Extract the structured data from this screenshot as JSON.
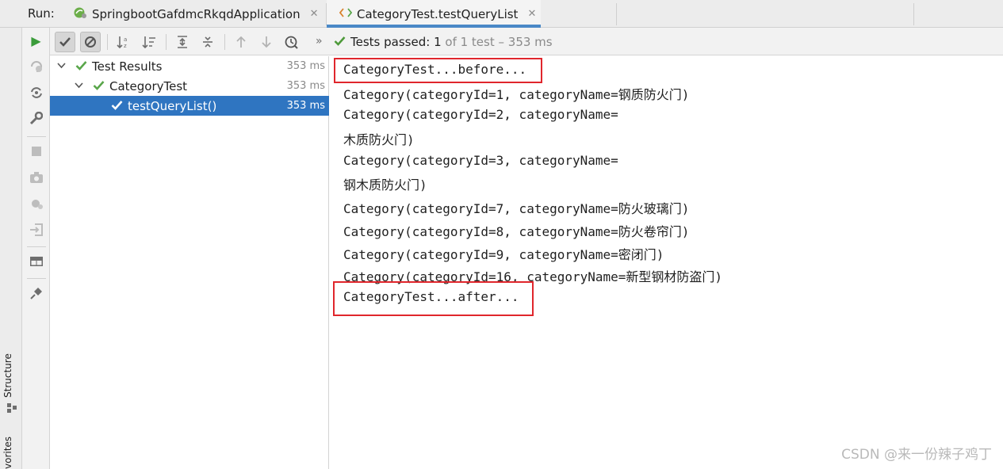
{
  "run_label": "Run:",
  "tabs": [
    {
      "label": "SpringbootGafdmcRkqdApplication",
      "close": "✕",
      "active": false
    },
    {
      "label": "CategoryTest.testQueryList",
      "close": "✕",
      "active": true
    }
  ],
  "side_labels": {
    "structure": "Structure",
    "favorites": "vorites"
  },
  "toolbar": {
    "more": "»",
    "status_prefix": "Tests passed:",
    "status_count": "1",
    "status_rest": "of 1 test – 353 ms"
  },
  "tree": [
    {
      "label": "Test Results",
      "duration": "353 ms",
      "level": 0,
      "selected": false
    },
    {
      "label": "CategoryTest",
      "duration": "353 ms",
      "level": 1,
      "selected": false
    },
    {
      "label": "testQueryList()",
      "duration": "353 ms",
      "level": 2,
      "selected": true
    }
  ],
  "console_lines": [
    "CategoryTest...before...",
    "Category(categoryId=1, categoryName=钢质防火门)",
    "Category(categoryId=2, categoryName=",
    "木质防火门)",
    "Category(categoryId=3, categoryName=",
    "钢木质防火门)",
    "Category(categoryId=7, categoryName=防火玻璃门)",
    "Category(categoryId=8, categoryName=防火卷帘门)",
    "Category(categoryId=9, categoryName=密闭门)",
    "Category(categoryId=16, categoryName=新型钢材防盗门)",
    "CategoryTest...after..."
  ],
  "watermark": "CSDN @来一份辣子鸡丁",
  "colors": {
    "selection": "#2f75c1",
    "pass_green": "#59a64a",
    "highlight_red": "#e0262c",
    "tab_underline": "#4a88c7"
  }
}
